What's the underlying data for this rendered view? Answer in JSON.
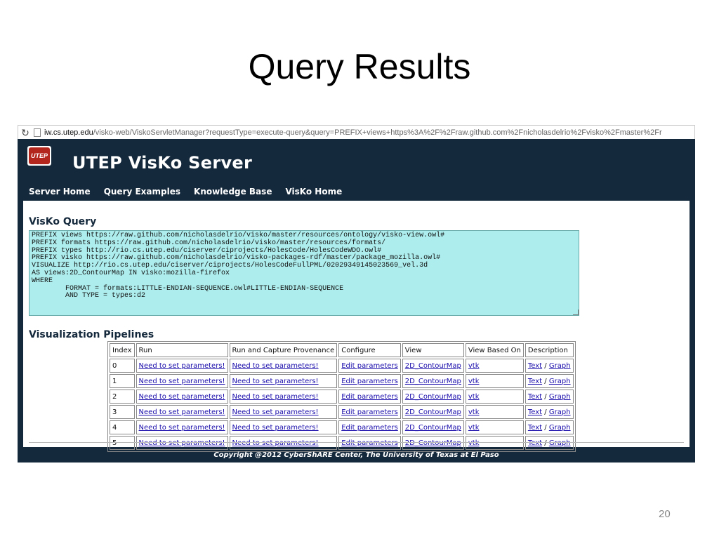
{
  "slide": {
    "title": "Query Results",
    "page_number": "20"
  },
  "browser": {
    "url_domain": "iw.cs.utep.edu",
    "url_rest": "/visko-web/ViskoServletManager?requestType=execute-query&query=PREFIX+views+https%3A%2F%2Fraw.github.com%2Fnicholasdelrio%2Fvisko%2Fmaster%2Fr",
    "reload_icon": "↻"
  },
  "site": {
    "logo_text": "UTEP",
    "title": "UTEP VisKo Server",
    "nav": [
      "Server Home",
      "Query Examples",
      "Knowledge Base",
      "VisKo Home"
    ],
    "query_heading": "VisKo Query",
    "query_text": "PREFIX views https://raw.github.com/nicholasdelrio/visko/master/resources/ontology/visko-view.owl#\nPREFIX formats https://raw.github.com/nicholasdelrio/visko/master/resources/formats/\nPREFIX types http://rio.cs.utep.edu/ciserver/ciprojects/HolesCode/HolesCodeWDO.owl#\nPREFIX visko https://raw.github.com/nicholasdelrio/visko-packages-rdf/master/package_mozilla.owl#\nVISUALIZE http://rio.cs.utep.edu/ciserver/ciprojects/HolesCodeFullPML/02029349145023569_vel.3d\nAS views:2D_ContourMap IN visko:mozilla-firefox\nWHERE\n        FORMAT = formats:LITTLE-ENDIAN-SEQUENCE.owl#LITTLE-ENDIAN-SEQUENCE\n        AND TYPE = types:d2",
    "pipelines_heading": "Visualization Pipelines",
    "table": {
      "headers": [
        "Index",
        "Run",
        "Run and Capture Provenance",
        "Configure",
        "View",
        "View Based On",
        "Description"
      ],
      "rows": [
        {
          "index": "0",
          "run": "Need to set parameters!",
          "run_prov": "Need to set parameters!",
          "configure": "Edit parameters",
          "view": "2D_ContourMap",
          "based_on": "vtk",
          "desc_text": "Text",
          "desc_sep": "/",
          "desc_graph": "Graph"
        },
        {
          "index": "1",
          "run": "Need to set parameters!",
          "run_prov": "Need to set parameters!",
          "configure": "Edit parameters",
          "view": "2D_ContourMap",
          "based_on": "vtk",
          "desc_text": "Text",
          "desc_sep": "/",
          "desc_graph": "Graph"
        },
        {
          "index": "2",
          "run": "Need to set parameters!",
          "run_prov": "Need to set parameters!",
          "configure": "Edit parameters",
          "view": "2D_ContourMap",
          "based_on": "vtk",
          "desc_text": "Text",
          "desc_sep": "/",
          "desc_graph": "Graph"
        },
        {
          "index": "3",
          "run": "Need to set parameters!",
          "run_prov": "Need to set parameters!",
          "configure": "Edit parameters",
          "view": "2D_ContourMap",
          "based_on": "vtk",
          "desc_text": "Text",
          "desc_sep": "/",
          "desc_graph": "Graph"
        },
        {
          "index": "4",
          "run": "Need to set parameters!",
          "run_prov": "Need to set parameters!",
          "configure": "Edit parameters",
          "view": "2D_ContourMap",
          "based_on": "vtk",
          "desc_text": "Text",
          "desc_sep": "/",
          "desc_graph": "Graph"
        },
        {
          "index": "5",
          "run": "Need to set parameters!",
          "run_prov": "Need to set parameters!",
          "configure": "Edit parameters",
          "view": "2D_ContourMap",
          "based_on": "vtk",
          "desc_text": "Text",
          "desc_sep": "/",
          "desc_graph": "Graph"
        }
      ]
    },
    "footer": "Copyright @2012 CyberShARE Center, The University of Texas at El Paso"
  },
  "colors": {
    "header_bg": "#15293c",
    "query_bg": "#aeeded",
    "link": "#1a0dab"
  }
}
